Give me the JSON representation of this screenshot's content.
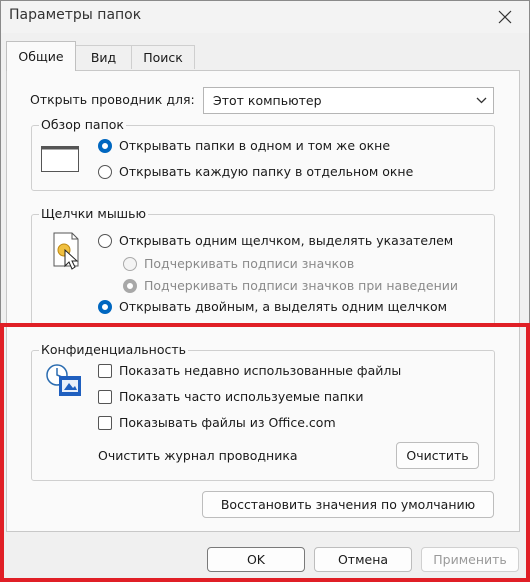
{
  "window": {
    "title": "Параметры папок"
  },
  "tabs": [
    {
      "label": "Общие",
      "active": true
    },
    {
      "label": "Вид",
      "active": false
    },
    {
      "label": "Поиск",
      "active": false
    }
  ],
  "open_explorer": {
    "label": "Открыть проводник для:",
    "value": "Этот компьютер"
  },
  "browse_folders": {
    "legend": "Обзор папок",
    "options": [
      {
        "label": "Открывать папки в одном и том же окне",
        "checked": true
      },
      {
        "label": "Открывать каждую папку в отдельном окне",
        "checked": false
      }
    ]
  },
  "mouse_clicks": {
    "legend": "Щелчки мышью",
    "single_click": {
      "label": "Открывать одним щелчком, выделять указателем",
      "checked": false
    },
    "sub_options": [
      {
        "label": "Подчеркивать подписи значков",
        "checked": false,
        "enabled": false
      },
      {
        "label": "Подчеркивать подписи значков при наведении",
        "checked": true,
        "enabled": false
      }
    ],
    "double_click": {
      "label": "Открывать двойным, а выделять одним щелчком",
      "checked": true
    }
  },
  "privacy": {
    "legend": "Конфиденциальность",
    "options": [
      {
        "label": "Показать недавно использованные файлы",
        "checked": false
      },
      {
        "label": "Показать часто используемые папки",
        "checked": false
      },
      {
        "label": "Показывать файлы из Office.com",
        "checked": false
      }
    ],
    "clear_label": "Очистить журнал проводника",
    "clear_button": "Очистить"
  },
  "restore_defaults": "Восстановить значения по умолчанию",
  "footer": {
    "ok": "OK",
    "cancel": "Отмена",
    "apply": "Применить"
  },
  "colors": {
    "accent": "#0067c0",
    "highlight": "#e01f26"
  }
}
